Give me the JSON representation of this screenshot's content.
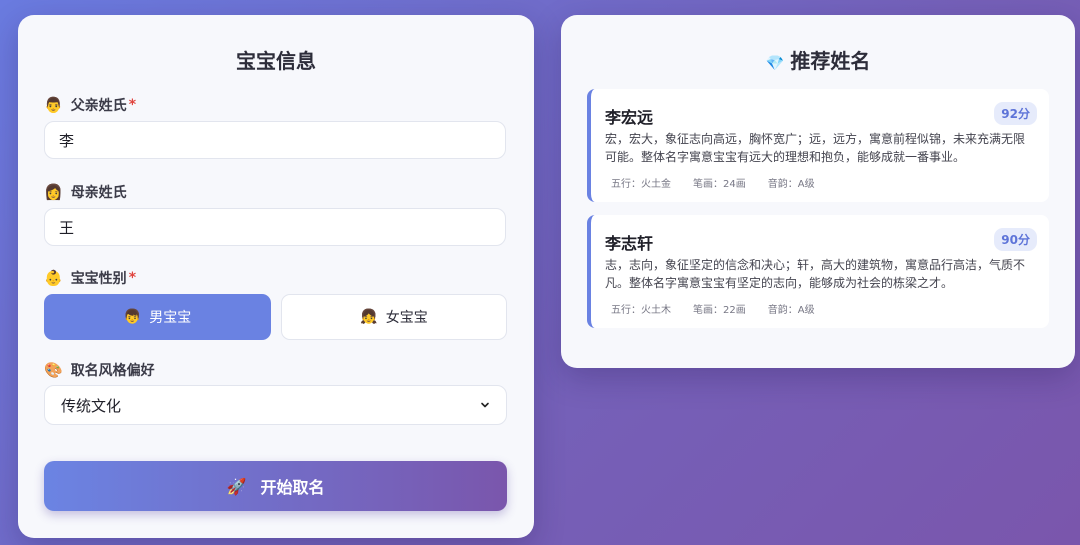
{
  "form": {
    "title": "宝宝信息",
    "father": {
      "emoji": "👨",
      "label": "父亲姓氏",
      "required": "*",
      "value": "李"
    },
    "mother": {
      "emoji": "👩",
      "label": "母亲姓氏",
      "value": "王"
    },
    "gender": {
      "emoji": "👶",
      "label": "宝宝性别",
      "required": "*",
      "male": {
        "emoji": "👦",
        "label": "男宝宝",
        "selected": true
      },
      "female": {
        "emoji": "👧",
        "label": "女宝宝",
        "selected": false
      }
    },
    "style": {
      "emoji": "🎨",
      "label": "取名风格偏好",
      "value": "传统文化"
    },
    "submit": {
      "emoji": "🚀",
      "label": "开始取名"
    }
  },
  "results": {
    "title_emoji": "💎",
    "title": "推荐姓名",
    "items": [
      {
        "name": "李宏远",
        "score": "92分",
        "desc": "宏，宏大，象征志向高远，胸怀宽广；远，远方，寓意前程似锦，未来充满无限可能。整体名字寓意宝宝有远大的理想和抱负，能够成就一番事业。",
        "wuxing": "五行：火土金",
        "strokes": "笔画：24画",
        "rhyme": "音韵：A级"
      },
      {
        "name": "李志轩",
        "score": "90分",
        "desc": "志，志向，象征坚定的信念和决心；轩，高大的建筑物，寓意品行高洁，气质不凡。整体名字寓意宝宝有坚定的志向，能够成为社会的栋梁之才。",
        "wuxing": "五行：火土木",
        "strokes": "笔画：22画",
        "rhyme": "音韵：A级"
      }
    ]
  },
  "colors": {
    "accent": "#6a82e2",
    "required": "#e0443e",
    "score_bg": "#e6ebfb"
  }
}
